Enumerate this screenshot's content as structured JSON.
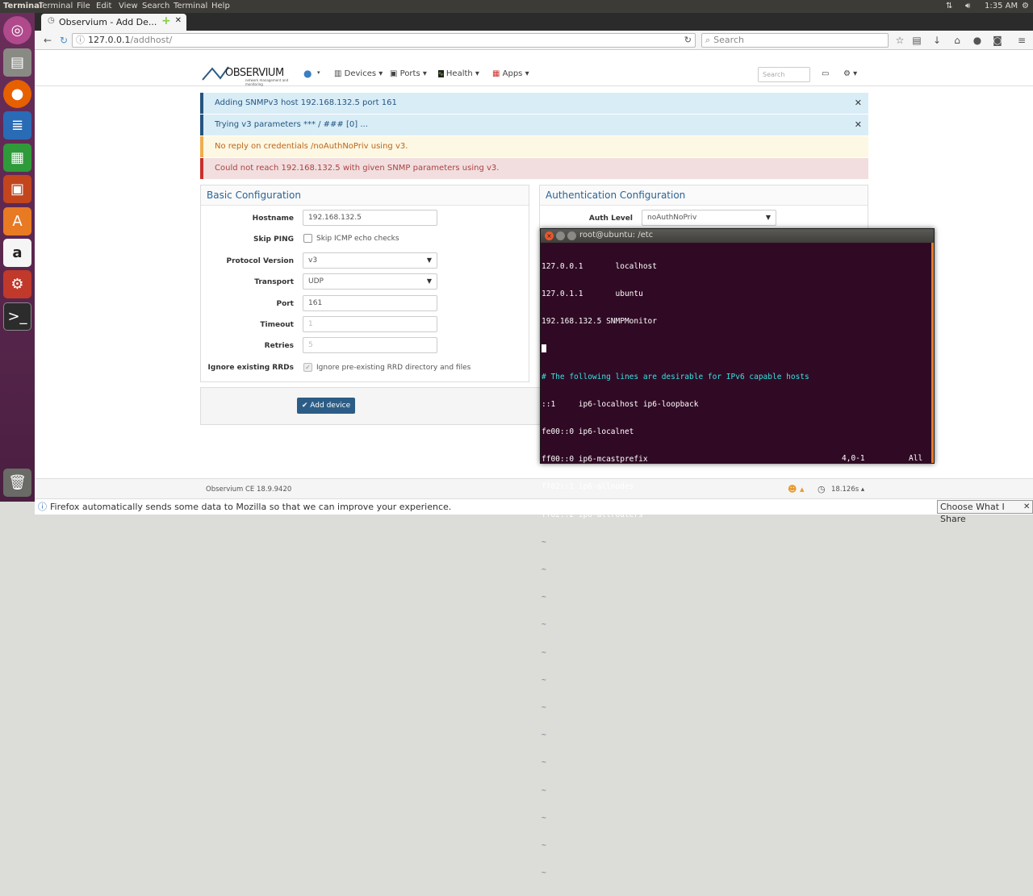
{
  "topbar": {
    "app_name": "Terminal",
    "menus": [
      "Terminal",
      "File",
      "Edit",
      "View",
      "Search",
      "Terminal",
      "Help"
    ],
    "time": "1:35 AM"
  },
  "launcher": {
    "icons": [
      "ubuntu-dash-icon",
      "files-icon",
      "firefox-icon",
      "writer-icon",
      "calc-icon",
      "impress-icon",
      "software-center-icon",
      "amazon-icon",
      "settings-icon",
      "terminal-icon",
      "trash-icon"
    ]
  },
  "browser": {
    "tab_title": "Observium - Add De...",
    "url_host": "127.0.0.1",
    "url_path": "/addhost/",
    "search_placeholder": "Search"
  },
  "obs_nav": {
    "logo": "OBSERVIUM",
    "tagline": "network management and monitoring",
    "devices": "Devices",
    "ports": "Ports",
    "health": "Health",
    "apps": "Apps",
    "search_placeholder": "Search"
  },
  "alerts": [
    {
      "text": "Adding SNMPv3 host 192.168.132.5 port 161",
      "type": "info"
    },
    {
      "text": "Trying v3 parameters *** / ### [0] ...",
      "type": "info"
    },
    {
      "text": "No reply on credentials /noAuthNoPriv using v3.",
      "type": "warning"
    },
    {
      "text": "Could not reach 192.168.132.5 with given SNMP parameters using v3.",
      "type": "danger"
    }
  ],
  "basic": {
    "title": "Basic Configuration",
    "hostname_label": "Hostname",
    "hostname_value": "192.168.132.5",
    "skip_ping_label": "Skip PING",
    "skip_ping_text": "Skip ICMP echo checks",
    "protocol_label": "Protocol Version",
    "protocol_value": "v3",
    "transport_label": "Transport",
    "transport_value": "UDP",
    "port_label": "Port",
    "port_value": "161",
    "timeout_label": "Timeout",
    "timeout_placeholder": "1",
    "retries_label": "Retries",
    "retries_placeholder": "5",
    "ignore_rrd_label": "Ignore existing RRDs",
    "ignore_rrd_text": "Ignore pre-existing RRD directory and files"
  },
  "auth": {
    "title": "Authentication Configuration",
    "level_label": "Auth Level",
    "level_value": "noAuthNoPriv"
  },
  "add_button": "Add device",
  "footer": {
    "version": "Observium CE 18.9.9420",
    "timing": "18.126s"
  },
  "notification": {
    "text": "Firefox automatically sends some data to Mozilla so that we can improve your experience.",
    "button": "Choose What I Share"
  },
  "terminal": {
    "title": "root@ubuntu: /etc",
    "lines": [
      "127.0.0.1       localhost",
      "127.0.1.1       ubuntu",
      "192.168.132.5 SNMPMonitor",
      "",
      "# The following lines are desirable for IPv6 capable hosts",
      "::1     ip6-localhost ip6-loopback",
      "fe00::0 ip6-localnet",
      "ff00::0 ip6-mcastprefix",
      "ff02::1 ip6-allnodes",
      "ff02::2 ip6-allrouters",
      "~",
      "~",
      "~",
      "~",
      "~",
      "~",
      "~",
      "~",
      "~",
      "~",
      "~",
      "~",
      "~"
    ],
    "cursor_pos": "4,0-1",
    "scroll": "All"
  },
  "colors": {
    "info_border": "#245580",
    "info_bg": "#d9edf7",
    "warn_border": "#f0ad4e",
    "warn_bg": "#fcf8e3",
    "danger_border": "#c9302c",
    "danger_bg": "#f2dede",
    "terminal_bg": "#300a24",
    "comment": "#34e2e2"
  }
}
